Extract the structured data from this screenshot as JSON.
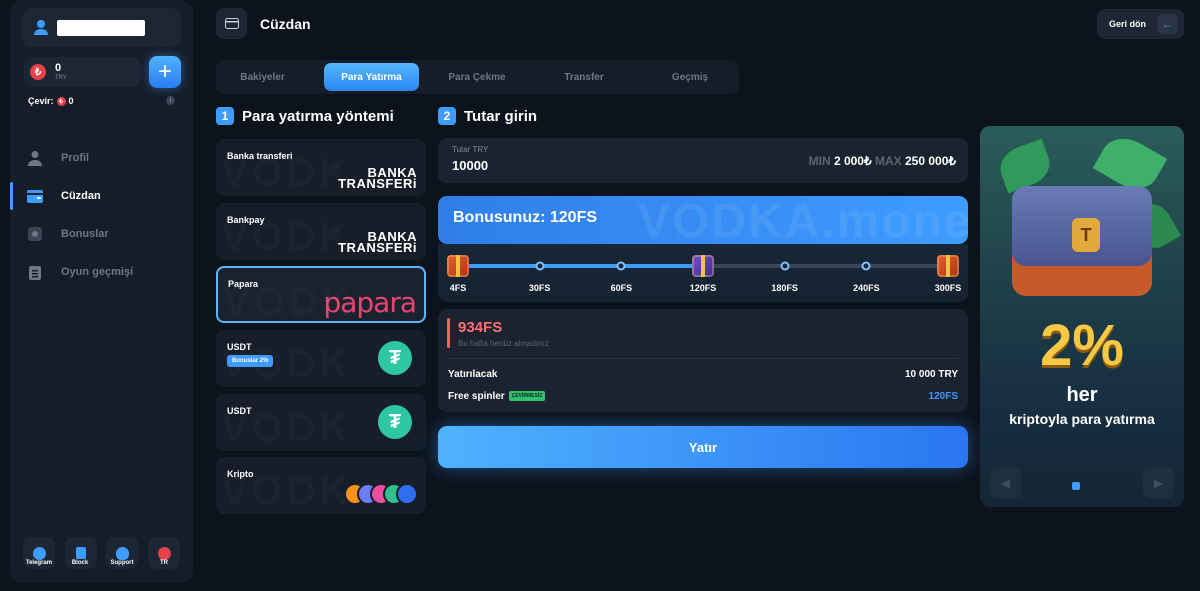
{
  "sidebar": {
    "balance": "0",
    "currency": "TRY",
    "coin_symbol": "₺",
    "cevir_label": "Çevir:",
    "cevir_value": "0",
    "nav": [
      {
        "label": "Profil",
        "icon": "user-icon"
      },
      {
        "label": "Cüzdan",
        "icon": "wallet-icon"
      },
      {
        "label": "Bonuslar",
        "icon": "gift-icon"
      },
      {
        "label": "Oyun geçmişi",
        "icon": "history-icon"
      }
    ],
    "bottom": [
      {
        "label": "Telegram",
        "icon": "telegram-icon"
      },
      {
        "label": "Block",
        "icon": "lock-icon"
      },
      {
        "label": "Support",
        "icon": "support-icon"
      },
      {
        "label": "TR",
        "icon": "turkey-flag-icon"
      }
    ]
  },
  "header": {
    "title": "Cüzdan",
    "back_label": "Geri dön"
  },
  "tabs": [
    "Bakiyeler",
    "Para Yatırma",
    "Para Çekme",
    "Transfer",
    "Geçmiş"
  ],
  "active_tab": "Para Yatırma",
  "section1": {
    "num": "1",
    "title": "Para yatırma yöntemi"
  },
  "section2": {
    "num": "2",
    "title": "Tutar girin"
  },
  "methods": [
    {
      "name": "Banka transferi",
      "logo_line1": "BANKA",
      "logo_line2": "TRANSFERi"
    },
    {
      "name": "Bankpay",
      "logo_line1": "BANKA",
      "logo_line2": "TRANSFERi"
    },
    {
      "name": "Papara",
      "logo": "papara"
    },
    {
      "name": "USDT",
      "badge": "Bonuslar 2%"
    },
    {
      "name": "USDT"
    },
    {
      "name": "Kripto"
    }
  ],
  "amount": {
    "label": "Tutar TRY",
    "value": "10000",
    "min_label": "MIN",
    "min_value": "2 000₺",
    "max_label": "MAX",
    "max_value": "250 000₺"
  },
  "bonus": {
    "title": "Bonusunuz: 120FS",
    "watermark": "VODKA.money",
    "steps": [
      "4FS",
      "30FS",
      "60FS",
      "120FS",
      "180FS",
      "240FS",
      "300FS"
    ],
    "progress_fraction": 0.5
  },
  "summary": {
    "fs_value": "934FS",
    "fs_sub": "Bu hafta henüz almadınız",
    "rows": [
      {
        "label": "Yatırılacak",
        "value": "10 000 TRY"
      },
      {
        "label": "Free spinler",
        "tag": "ÇEVİRMESİZ",
        "value": "120FS"
      }
    ]
  },
  "submit_label": "Yatır",
  "promo": {
    "percent": "2%",
    "line1": "her",
    "line2": "kriptoyla para yatırma",
    "chest_letter": "T"
  },
  "colors": {
    "accent": "#3f9cff",
    "danger": "#ff6f73",
    "papara": "#e8456f",
    "tether": "#2ec7a3"
  }
}
